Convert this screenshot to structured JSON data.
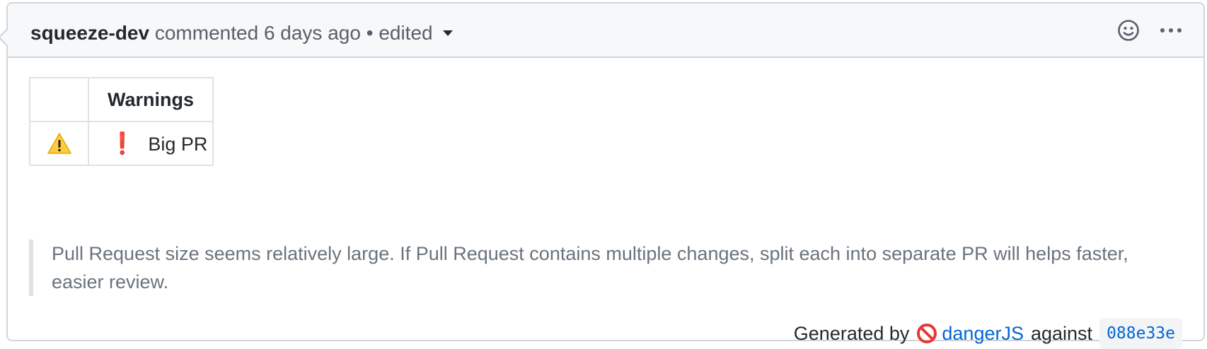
{
  "comment": {
    "author": "squeeze-dev",
    "action": "commented",
    "time": "6 days ago",
    "separator": "•",
    "edited_label": "edited",
    "actions": {
      "reaction_icon": "smiley-icon",
      "more_icon": "kebab-horizontal-icon"
    }
  },
  "warnings_table": {
    "header": "Warnings",
    "rows": [
      {
        "icon": "warning-icon",
        "marker": "❗",
        "text": "Big PR"
      }
    ]
  },
  "quote": {
    "text": "Pull Request size seems relatively large. If Pull Request contains multiple changes, split each into separate PR will helps faster, easier review."
  },
  "footer": {
    "generated_by": "Generated by",
    "tool_icon": "no-entry-icon",
    "tool_link": "dangerJS",
    "against": "against",
    "commit_sha": "088e33e"
  },
  "colors": {
    "link": "#0366d6",
    "header_bg": "#f6f8fa",
    "border": "#d1d5da",
    "warning_yellow": "#ffcc3d",
    "error_red": "#e00000"
  }
}
